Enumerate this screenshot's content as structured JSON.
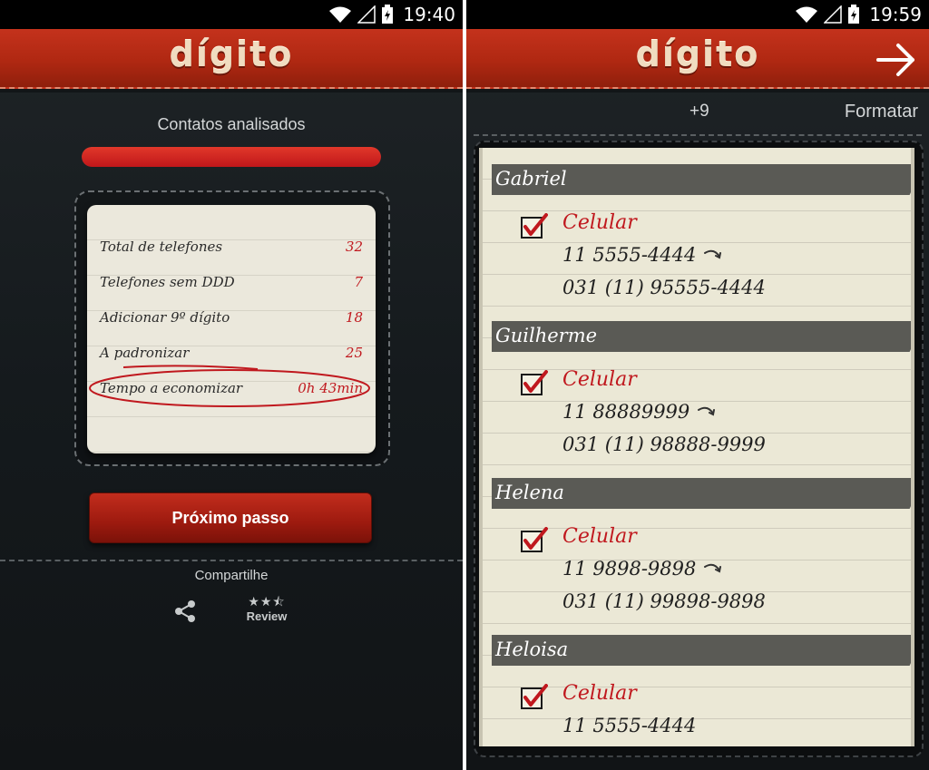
{
  "left": {
    "status": {
      "time": "19:40"
    },
    "app": {
      "logo": "dígito"
    },
    "analysis": {
      "title": "Contatos analisados",
      "progress": 1.0,
      "stats": [
        {
          "label": "Total de telefones",
          "value": "32"
        },
        {
          "label": "Telefones sem DDD",
          "value": "7"
        },
        {
          "label": "Adicionar 9º dígito",
          "value": "18"
        },
        {
          "label": "A padronizar",
          "value": "25"
        },
        {
          "label": "Tempo a economizar",
          "value": "0h 43min"
        }
      ]
    },
    "next_button": "Próximo passo",
    "share": {
      "label": "Compartilhe",
      "review_label": "Review",
      "stars": "★★⯪"
    }
  },
  "right": {
    "status": {
      "time": "19:59"
    },
    "app": {
      "logo": "dígito"
    },
    "toolbar": {
      "count": "+9",
      "format_label": "Formatar"
    },
    "contacts": [
      {
        "name": "Gabriel",
        "type": "Celular",
        "old_number": "11 5555-4444",
        "new_number": "031 (11) 95555-4444",
        "checked": true
      },
      {
        "name": "Guilherme",
        "type": "Celular",
        "old_number": "11 88889999",
        "new_number": "031 (11) 98888-9999",
        "checked": true
      },
      {
        "name": "Helena",
        "type": "Celular",
        "old_number": "11 9898-9898",
        "new_number": "031 (11) 99898-9898",
        "checked": true
      },
      {
        "name": "Heloisa",
        "type": "Celular",
        "old_number": "11 5555-4444",
        "new_number": "",
        "checked": true
      }
    ]
  },
  "colors": {
    "accent_red": "#c0181e",
    "bar_red": "#b02812",
    "paper": "#ebe8d6",
    "tab_gray": "#5a5a55"
  },
  "icons": {
    "wifi": "wifi-icon",
    "signal": "cell-signal-icon",
    "battery": "battery-charging-icon",
    "share": "share-icon",
    "arrow": "arrow-right-icon",
    "check": "checkbox-checked-icon"
  }
}
